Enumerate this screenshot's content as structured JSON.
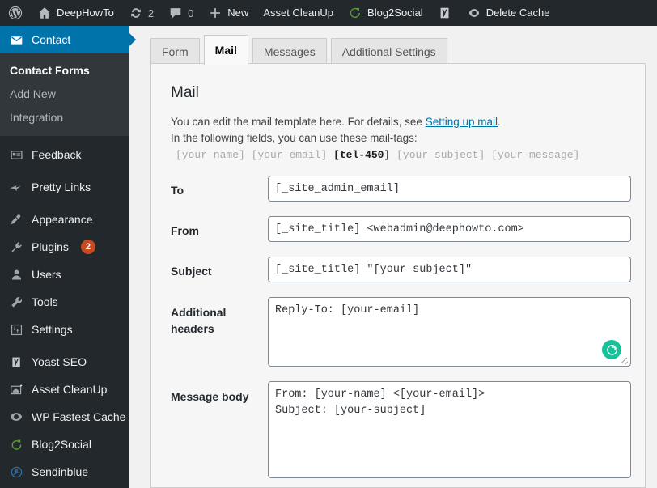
{
  "adminbar": {
    "items": [
      {
        "icon": "wordpress-logo-icon",
        "label": "",
        "interactable": true
      },
      {
        "icon": "home-icon",
        "label": "DeepHowTo",
        "interactable": true
      },
      {
        "icon": "updates-icon",
        "label": "2",
        "interactable": true
      },
      {
        "icon": "comment-bubble-icon",
        "label": "0",
        "interactable": true
      },
      {
        "icon": "plus-icon",
        "label": "New",
        "interactable": true
      },
      {
        "icon": "",
        "label": "Asset CleanUp",
        "interactable": true
      },
      {
        "icon": "blog2social-icon",
        "label": "Blog2Social",
        "interactable": true
      },
      {
        "icon": "yoast-seo-icon",
        "label": "",
        "interactable": true
      },
      {
        "icon": "wp-fastest-cache-icon",
        "label": "Delete Cache",
        "interactable": true
      }
    ]
  },
  "sidebar": {
    "current": {
      "icon": "envelope-icon",
      "label": "Contact",
      "submenu": [
        {
          "label": "Contact Forms",
          "current": true
        },
        {
          "label": "Add New",
          "current": false
        },
        {
          "label": "Integration",
          "current": false
        }
      ]
    },
    "items": [
      {
        "icon": "feedback-icon",
        "label": "Feedback",
        "badge": ""
      },
      {
        "icon": "pretty-links-icon",
        "label": "Pretty Links",
        "badge": ""
      },
      {
        "icon": "appearance-icon",
        "label": "Appearance",
        "badge": ""
      },
      {
        "icon": "plugins-icon",
        "label": "Plugins",
        "badge": "2"
      },
      {
        "icon": "users-icon",
        "label": "Users",
        "badge": ""
      },
      {
        "icon": "tools-icon",
        "label": "Tools",
        "badge": ""
      },
      {
        "icon": "settings-icon",
        "label": "Settings",
        "badge": ""
      },
      {
        "icon": "yoast-seo-icon",
        "label": "Yoast SEO",
        "badge": ""
      },
      {
        "icon": "asset-cleanup-icon",
        "label": "Asset CleanUp",
        "badge": ""
      },
      {
        "icon": "wp-fastest-cache-icon",
        "label": "WP Fastest Cache",
        "badge": ""
      },
      {
        "icon": "blog2social-icon",
        "label": "Blog2Social",
        "badge": ""
      },
      {
        "icon": "sendinblue-icon",
        "label": "Sendinblue",
        "badge": ""
      }
    ]
  },
  "tabs": [
    {
      "label": "Form",
      "active": false
    },
    {
      "label": "Mail",
      "active": true
    },
    {
      "label": "Messages",
      "active": false
    },
    {
      "label": "Additional Settings",
      "active": false
    }
  ],
  "panel": {
    "title": "Mail",
    "desc_line1_pre": "You can edit the mail template here. For details, see ",
    "desc_link": "Setting up mail",
    "desc_line1_post": ".",
    "desc_line2": "In the following fields, you can use these mail-tags:",
    "mailtags": [
      "[your-name]",
      "[your-email]",
      "[tel-450]",
      "[your-subject]",
      "[your-message]"
    ],
    "mailtag_bold_index": 2
  },
  "fields": {
    "to": {
      "label": "To",
      "value": "[_site_admin_email]"
    },
    "from": {
      "label": "From",
      "value": "[_site_title] <webadmin@deephowto.com>"
    },
    "subject": {
      "label": "Subject",
      "value": "[_site_title] \"[your-subject]\""
    },
    "additional_headers": {
      "label": "Additional headers",
      "value": "Reply-To: [your-email]"
    },
    "message_body": {
      "label": "Message body",
      "value": "From: [your-name] <[your-email]>\nSubject: [your-subject]"
    }
  },
  "colors": {
    "admin_bar_bg": "#23282d",
    "sidebar_bg": "#23282d",
    "submenu_bg": "#32373c",
    "active_blue": "#0073aa",
    "badge_red": "#ca4a1f",
    "link_blue": "#0073aa",
    "grammarly_green": "#15c39a"
  },
  "grammarly": {
    "name": "grammarly-icon",
    "letter": "G"
  }
}
